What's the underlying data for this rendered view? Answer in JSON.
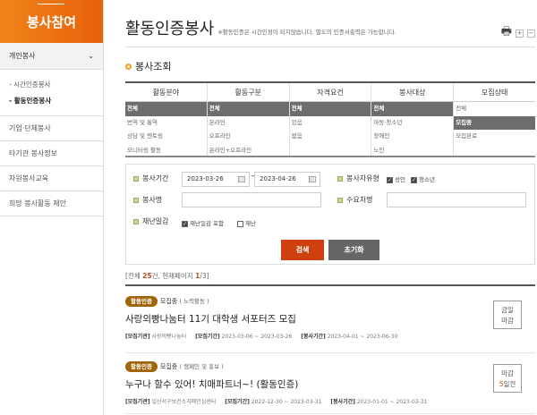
{
  "sidebar": {
    "title": "봉사참여",
    "group": "개인봉사",
    "subs": [
      "- 시간인증봉사",
      "- 활동인증봉사"
    ],
    "items": [
      "기업·단체봉사",
      "타기관 봉사정보",
      "자원봉사교육",
      "희망 봉사활동 제안"
    ]
  },
  "header": {
    "title": "활동인증봉사",
    "note": "※활동인증은 시간인정이 되지않습니다. 별도의 인증서출력은 가능합니다.",
    "plus": "+",
    "minus": "−"
  },
  "section": "봉사조회",
  "filters": [
    {
      "label": "활동분야",
      "options": [
        "전체",
        "번역 및 통역",
        "상담 및 멘토링",
        "모니터링 활동"
      ],
      "selected": 0
    },
    {
      "label": "활동구분",
      "options": [
        "전체",
        "온라인",
        "오프라인",
        "온라인+오프라인"
      ],
      "selected": 0
    },
    {
      "label": "자격요건",
      "options": [
        "전체",
        "있음",
        "없음"
      ],
      "selected": 0
    },
    {
      "label": "봉사대상",
      "options": [
        "전체",
        "아동·청소년",
        "장애인",
        "노인"
      ],
      "selected": 0
    },
    {
      "label": "모집상태",
      "options": [
        "전체",
        "모집중",
        "모집완료"
      ],
      "selected": 1
    }
  ],
  "search": {
    "period_label": "봉사기간",
    "start": "2023-03-26",
    "tilde": "~",
    "end": "2023-04-26",
    "type_label": "봉사자유형",
    "adult": "성인",
    "youth": "청소년",
    "name_label": "봉사명",
    "org_label": "수요처명",
    "disaster_label": "재난일감",
    "incl_disaster": "재난일감 포함",
    "disaster": "재난",
    "search_btn": "검색",
    "reset_btn": "초기화"
  },
  "count": {
    "pre": "[전체 ",
    "total": "25",
    "mid": "건, 현재페이지 ",
    "page": "1",
    "post": "/3]"
  },
  "results": [
    {
      "badge": "활동인증",
      "status": "모집중",
      "cat": "( 노력활동 )",
      "title": "사랑의빵나눔터 11기 대학생 서포터즈 모집",
      "org_label": "[모집기관]",
      "org": "사랑의빵나눔터",
      "rec_label": "[모집기간]",
      "rec": "2023-03-06 ~ 2023-03-26",
      "svc_label": "[봉사기간]",
      "svc": "2023-04-01 ~ 2023-06-30",
      "dl1": "금일",
      "dl2": "마감",
      "dl2o": ""
    },
    {
      "badge": "활동인증",
      "status": "모집중",
      "cat": "( 캠페인 및 홍보 )",
      "title": "누구나 할수 있어! 치매파트너~! (활동인증)",
      "org_label": "[모집기관]",
      "org": "일산서구보건소치매안심센터",
      "rec_label": "[모집기간]",
      "rec": "2022-12-30 ~ 2023-03-31",
      "svc_label": "[봉사기간]",
      "svc": "2023-01-01 ~ 2023-03-31",
      "dl1": "마감",
      "dl2o": "5",
      "dl2": "일전"
    }
  ]
}
